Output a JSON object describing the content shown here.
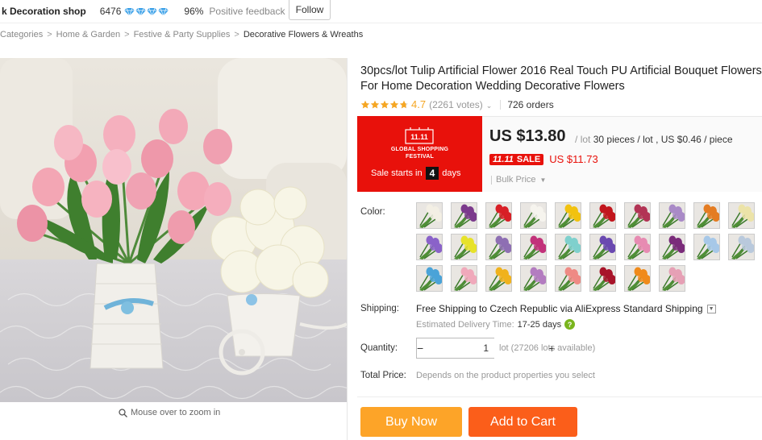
{
  "store": {
    "name": "k Decoration shop",
    "score": "6476",
    "feedback_pct": "96%",
    "feedback_label": "Positive feedback",
    "follow_label": "Follow"
  },
  "breadcrumb": [
    "Categories",
    "Home & Garden",
    "Festive & Party Supplies",
    "Decorative Flowers & Wreaths"
  ],
  "zoom_hint": "Mouse over to zoom in",
  "product": {
    "title": "30pcs/lot Tulip Artificial Flower 2016 Real Touch PU Artificial Bouquet Flowers For Home Decoration Wedding Decorative Flowers",
    "rating": "4.7",
    "rating_fraction": 0.94,
    "votes": "(2261 votes)",
    "orders": "726 orders"
  },
  "sale_banner": {
    "logo_text": "11.11",
    "line1": "GLOBAL SHOPPING",
    "line2": "FESTIVAL",
    "starts_label": "Sale starts in",
    "days_value": "4",
    "days_label": "days"
  },
  "price": {
    "main": "US $13.80",
    "unit_slash": "/",
    "unit_lot": "lot",
    "pieces": "30 pieces / lot , US $0.46 / piece",
    "sale_tag_logo": "11.11",
    "sale_tag": "SALE",
    "sale_price": "US $11.73",
    "bulk_label": "Bulk Price"
  },
  "colors": {
    "label": "Color:",
    "swatches": [
      {
        "name": "swatch-white-tulip",
        "color": "#f3efe4"
      },
      {
        "name": "swatch-purple-tulip",
        "color": "#7b3a8c"
      },
      {
        "name": "swatch-red-tulip",
        "color": "#d81f26"
      },
      {
        "name": "swatch-white2-tulip",
        "color": "#f6f4ee"
      },
      {
        "name": "swatch-yellow-tulip",
        "color": "#f2c20f"
      },
      {
        "name": "swatch-deep-red-tulip",
        "color": "#c2161d"
      },
      {
        "name": "swatch-rose-tulip",
        "color": "#b23455"
      },
      {
        "name": "swatch-lavender-tulip",
        "color": "#a98ac7"
      },
      {
        "name": "swatch-orange-tulip",
        "color": "#e47c22"
      },
      {
        "name": "swatch-cream-tulip",
        "color": "#ece3a8"
      },
      {
        "name": "swatch-violet-tulip",
        "color": "#8a62c9"
      },
      {
        "name": "swatch-lemon-tulip",
        "color": "#e7e22a"
      },
      {
        "name": "swatch-mauve-tulip",
        "color": "#8e6fb3"
      },
      {
        "name": "swatch-magenta-tulip",
        "color": "#c2327a"
      },
      {
        "name": "swatch-aqua-tulip",
        "color": "#7fd0cd"
      },
      {
        "name": "swatch-indigo-tulip",
        "color": "#6a49b0"
      },
      {
        "name": "swatch-pink-tulip",
        "color": "#e78bb2"
      },
      {
        "name": "swatch-plum-tulip",
        "color": "#7a2b7a"
      },
      {
        "name": "swatch-sky-tulip",
        "color": "#a7c8e8"
      },
      {
        "name": "swatch-pale-blue-tulip",
        "color": "#b9c9dc"
      },
      {
        "name": "swatch-blue-tulip",
        "color": "#4aa3d8"
      },
      {
        "name": "swatch-blush-tulip",
        "color": "#f0a9bb"
      },
      {
        "name": "swatch-gold-tulip",
        "color": "#f0b21d"
      },
      {
        "name": "swatch-lilac-tulip",
        "color": "#b37cc0"
      },
      {
        "name": "swatch-salmon-tulip",
        "color": "#ef8a84"
      },
      {
        "name": "swatch-crimson-tulip",
        "color": "#a8142a"
      },
      {
        "name": "swatch-tangerine-tulip",
        "color": "#f08a1a"
      },
      {
        "name": "swatch-light-pink-tulip",
        "color": "#e6a0b5"
      }
    ]
  },
  "shipping": {
    "label": "Shipping:",
    "value": "Free Shipping to Czech Republic via AliExpress Standard Shipping",
    "delivery_label": "Estimated Delivery Time:",
    "delivery_days": "17-25 days"
  },
  "quantity": {
    "label": "Quantity:",
    "value": "1",
    "minus": "−",
    "plus": "+",
    "available": "lot (27206 lots available)"
  },
  "total": {
    "label": "Total Price:",
    "hint": "Depends on the product properties you select"
  },
  "actions": {
    "buy_now": "Buy Now",
    "add_to_cart": "Add to Cart"
  },
  "theme": {
    "accent_red": "#e8110b",
    "buy_orange": "#fda428",
    "cart_orange": "#fb5e1a",
    "star_color": "#f5a623"
  }
}
